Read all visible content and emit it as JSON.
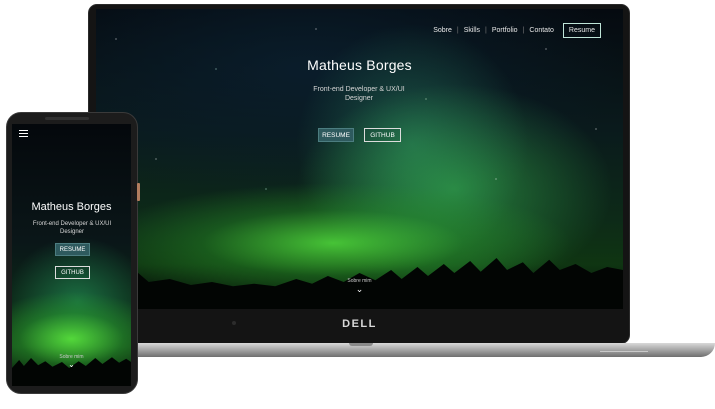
{
  "laptop": {
    "nav": {
      "items": [
        "Sobre",
        "Skills",
        "Portfolio",
        "Contato"
      ],
      "separator": "|",
      "resume_label": "Resume"
    },
    "hero": {
      "name": "Matheus Borges",
      "tagline": "Front-end Developer & UX/UI Designer",
      "resume_button": "RESUME",
      "github_button": "GITHUB",
      "scroll_label": "Sobre mim",
      "scroll_icon": "chevron-down-icon"
    },
    "brand": "DELL"
  },
  "phone": {
    "menu_icon": "hamburger-menu-icon",
    "hero": {
      "name": "Matheus Borges",
      "tagline": "Front-end Developer & UX/UI Designer",
      "resume_button": "RESUME",
      "github_button": "GITHUB",
      "scroll_label": "Sobre mim",
      "scroll_icon": "chevron-down-icon"
    }
  },
  "colors": {
    "accent_button": "#2e5a5e",
    "aurora_green": "#50dc3c",
    "background": "#050a10"
  }
}
